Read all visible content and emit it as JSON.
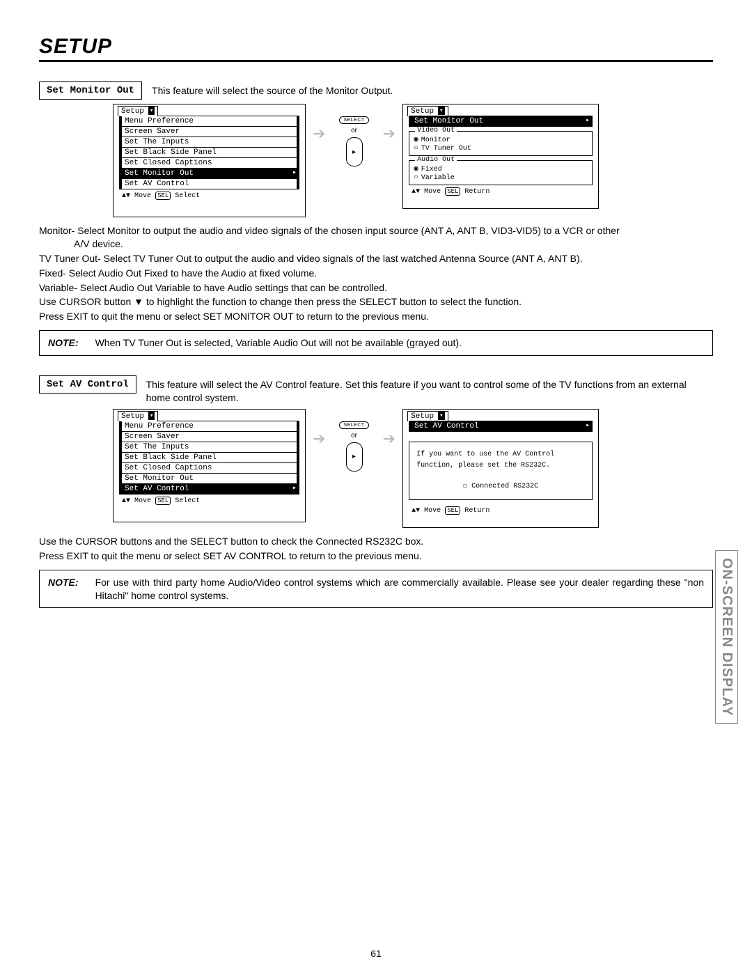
{
  "page": {
    "title": "Setup",
    "number": "61",
    "side_tab": "ON-SCREEN DISPLAY"
  },
  "sec1": {
    "label": "Set Monitor Out",
    "desc": "This feature will select the source of the Monitor Output.",
    "menu_title": "Setup",
    "items": [
      "Menu Preference",
      "Screen Saver",
      "Set The Inputs",
      "Set Black Side Panel",
      "Set Closed Captions",
      "Set Monitor Out",
      "Set AV Control"
    ],
    "hint_move": "Move",
    "hint_sel": "SEL",
    "hint_select": "Select",
    "arrow_select": "SELECT",
    "arrow_or": "or",
    "right_title": "Setup",
    "right_hl": "Set Monitor Out",
    "video_legend": "Video Out",
    "video_opt1": "Monitor",
    "video_opt2": "TV Tuner Out",
    "audio_legend": "Audio Out",
    "audio_opt1": "Fixed",
    "audio_opt2": "Variable",
    "right_hint_move": "Move",
    "right_hint_sel": "SEL",
    "right_hint_return": "Return",
    "para1a": "Monitor- Select Monitor to output the audio and video signals of the chosen input source (ANT A, ANT B, VID3-VID5) to a VCR or other",
    "para1b": "A/V device.",
    "para2": "TV Tuner Out- Select TV Tuner Out to output the audio and video signals of the last watched Antenna Source (ANT A, ANT B).",
    "para3": "Fixed-  Select Audio Out Fixed to have the Audio at fixed volume.",
    "para4": "Variable- Select Audio Out Variable to have Audio settings that can be controlled.",
    "para5": "Use CURSOR button ▼ to highlight the function to change then press the SELECT button to select the function.",
    "para6": "Press EXIT to quit the menu or select SET MONITOR OUT to return to the previous menu.",
    "note_label": "NOTE",
    "note": "When TV Tuner Out is selected, Variable Audio Out will not be available (grayed out)."
  },
  "sec2": {
    "label": "Set AV Control",
    "desc": "This feature will select the AV Control feature.  Set this feature if you want to control some of the TV functions from an external home control system.",
    "menu_title": "Setup",
    "items": [
      "Menu Preference",
      "Screen Saver",
      "Set The Inputs",
      "Set Black Side Panel",
      "Set Closed Captions",
      "Set Monitor Out",
      "Set AV Control"
    ],
    "hint_move": "Move",
    "hint_sel": "SEL",
    "hint_select": "Select",
    "arrow_select": "SELECT",
    "arrow_or": "or",
    "right_title": "Setup",
    "right_hl": "Set AV Control",
    "msg_line1": "If you want to use the AV Control",
    "msg_line2": "function, please set the RS232C.",
    "check_label": "Connected RS232C",
    "right_hint_move": "Move",
    "right_hint_sel": "SEL",
    "right_hint_return": "Return",
    "para1": "Use the CURSOR buttons and the SELECT button to check the Connected RS232C box.",
    "para2": "Press EXIT to quit the menu or select SET AV CONTROL to return to the previous menu.",
    "note_label": "NOTE",
    "note": "For use with third party home Audio/Video control systems which are commercially available.  Please see your dealer regarding these \"non Hitachi\" home control systems."
  }
}
